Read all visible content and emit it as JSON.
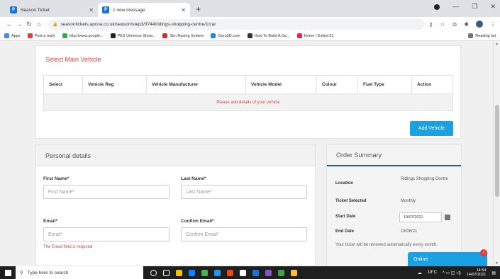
{
  "browser": {
    "tabs": [
      {
        "title": "Season Ticket",
        "icon": "site-favicon",
        "active": false
      },
      {
        "title": "1 new message",
        "icon": "site-favicon",
        "active": true
      }
    ],
    "url": "seasontickets.apcoa.co.uk/season/step3/3744/ridings-shopping-centre/1/car",
    "bookmarks": [
      "Apps",
      "Post a reply",
      "http://www.google...",
      "PES Universe Show...",
      "Sim Racing System",
      "Guru3D.com",
      "How To Build A Ga...",
      "Home / Exiled 51"
    ],
    "reading_list": "Reading list"
  },
  "vehicle_section": {
    "title": "Select Main Vehicle",
    "columns": [
      "Select",
      "Vehicle Reg",
      "Vehicle Manufacturer",
      "Vehicle Model",
      "Colour",
      "Fuel Type",
      "Action"
    ],
    "empty_message": "Please add details of your vehicle",
    "add_button": "Add Vehicle"
  },
  "personal": {
    "title": "Personal details",
    "first_name_label": "First Name*",
    "first_name_placeholder": "First Name*",
    "last_name_label": "Last Name*",
    "last_name_placeholder": "Last Name*",
    "email_label": "Email*",
    "email_placeholder": "Email*",
    "email_error": "The Email field is required",
    "confirm_email_label": "Confirm Email*",
    "confirm_email_placeholder": "Confirm Email*"
  },
  "summary": {
    "title": "Order Summary",
    "location_label": "Location",
    "location_value": "Ridings Shopping Centre",
    "ticket_label": "Ticket Selected",
    "ticket_value": "Monthly",
    "start_label": "Start Date",
    "start_value": "19/07/2021",
    "end_label": "End Date",
    "end_value": "18/08/21",
    "note": "Your ticket will be renewed automatically every month."
  },
  "chat": {
    "label": "Online",
    "badge": "1"
  },
  "taskbar": {
    "search_placeholder": "Type here to search",
    "weather": "19°C",
    "time": "14:54",
    "date": "14/07/2021"
  },
  "colors": {
    "accent": "#1ba1e2",
    "error": "#e04848",
    "summary_rule": "#2a5b8a"
  }
}
